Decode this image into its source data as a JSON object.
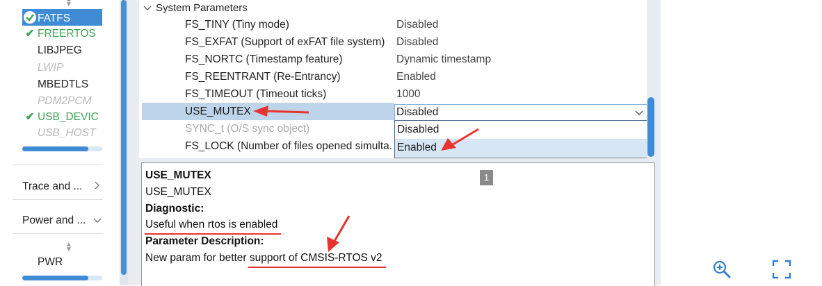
{
  "sidebar": {
    "middleware_items": [
      {
        "label": "FATFS",
        "state": "selected"
      },
      {
        "label": "FREERTOS",
        "state": "checked"
      },
      {
        "label": "LIBJPEG",
        "state": "plain"
      },
      {
        "label": "LWIP",
        "state": "disabled"
      },
      {
        "label": "MBEDTLS",
        "state": "plain"
      },
      {
        "label": "PDM2PCM",
        "state": "disabled"
      },
      {
        "label": "USB_DEVIC",
        "state": "checked"
      },
      {
        "label": "USB_HOST",
        "state": "disabled"
      }
    ],
    "categories": [
      {
        "label": "Trace and ...",
        "icon": "chevron-right-icon"
      },
      {
        "label": "Power and ...",
        "icon": "chevron-down-icon"
      }
    ],
    "power_items": [
      {
        "label": "PWR"
      }
    ]
  },
  "parameters": {
    "group_label": "System Parameters",
    "rows": [
      {
        "name": "FS_TINY (Tiny mode)",
        "value": "Disabled"
      },
      {
        "name": "FS_EXFAT (Support of exFAT file system)",
        "value": "Disabled"
      },
      {
        "name": "FS_NORTC (Timestamp feature)",
        "value": "Dynamic timestamp"
      },
      {
        "name": "FS_REENTRANT (Re-Entrancy)",
        "value": "Enabled"
      },
      {
        "name": "FS_TIMEOUT (Timeout ticks)",
        "value": "1000"
      },
      {
        "name": "USE_MUTEX",
        "value": "Disabled"
      },
      {
        "name": "SYNC_t (O/S sync object)",
        "value": ""
      },
      {
        "name": "FS_LOCK (Number of files opened simulta.",
        "value": ""
      }
    ],
    "dropdown": {
      "current": "Disabled",
      "options": [
        "Disabled",
        "Enabled"
      ],
      "hovered": "Enabled"
    }
  },
  "description": {
    "title": "USE_MUTEX",
    "name": "USE_MUTEX",
    "diagnostic_label": "Diagnostic:",
    "diagnostic_text": "Useful when rtos is enabled",
    "param_desc_label": "Parameter Description:",
    "param_desc_text": "New param for better support of CMSIS-RTOS v2",
    "page_number": "1"
  },
  "colors": {
    "accent": "#3f8bd6",
    "checked_green": "#3aa655",
    "annotation_red": "#e8342e",
    "row_selected": "#bdd4ea"
  },
  "toolbar": {
    "icons": [
      "zoom-in-icon",
      "fit-screen-icon"
    ]
  }
}
